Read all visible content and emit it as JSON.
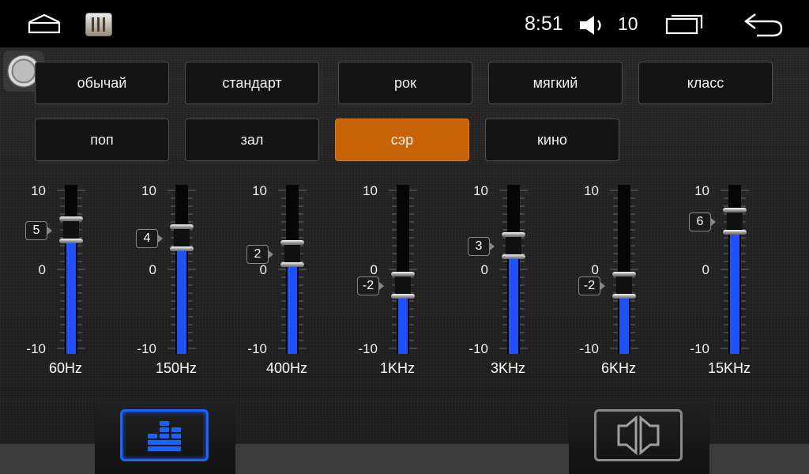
{
  "status": {
    "time": "8:51",
    "volume": "10"
  },
  "presets": [
    {
      "label": "обычай",
      "active": false
    },
    {
      "label": "стандарт",
      "active": false
    },
    {
      "label": "рок",
      "active": false
    },
    {
      "label": "мягкий",
      "active": false
    },
    {
      "label": "класс",
      "active": false
    },
    {
      "label": "поп",
      "active": false
    },
    {
      "label": "зал",
      "active": false
    },
    {
      "label": "сэр",
      "active": true
    },
    {
      "label": "кино",
      "active": false
    }
  ],
  "scale": {
    "max": "10",
    "zero": "0",
    "min": "-10"
  },
  "bands": [
    {
      "freq": "60Hz",
      "value": 5,
      "value_label": "5"
    },
    {
      "freq": "150Hz",
      "value": 4,
      "value_label": "4"
    },
    {
      "freq": "400Hz",
      "value": 2,
      "value_label": "2"
    },
    {
      "freq": "1KHz",
      "value": -2,
      "value_label": "-2"
    },
    {
      "freq": "3KHz",
      "value": 3,
      "value_label": "3"
    },
    {
      "freq": "6KHz",
      "value": -2,
      "value_label": "-2"
    },
    {
      "freq": "15KHz",
      "value": 6,
      "value_label": "6"
    }
  ],
  "colors": {
    "accent": "#c86407",
    "fill": "#1e52ff",
    "tab_active": "#1b63ff",
    "tab_inactive": "#8a8a8a"
  },
  "icons": {
    "home": "home-icon",
    "app": "equalizer-app-icon",
    "volume": "speaker-icon",
    "recent": "recent-apps-icon",
    "back": "back-icon",
    "eq_tab": "equalizer-bars-icon",
    "balance_tab": "speaker-balance-icon"
  }
}
